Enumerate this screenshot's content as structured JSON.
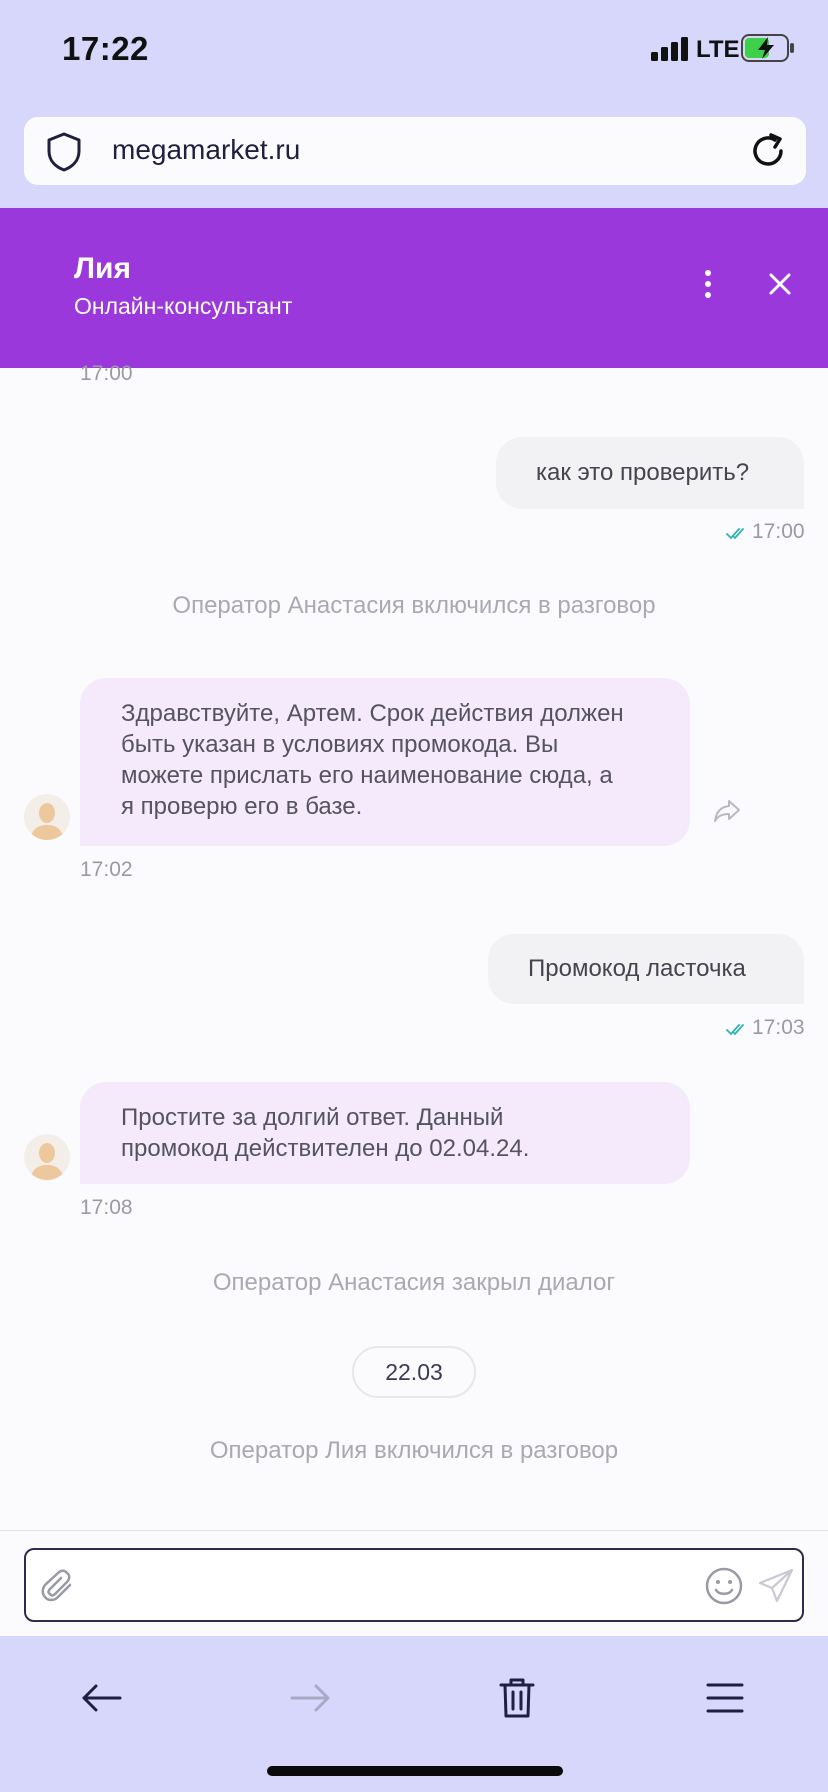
{
  "status_bar": {
    "time": "17:22",
    "network": "LTE"
  },
  "browser": {
    "url": "megamarket.ru"
  },
  "chat_header": {
    "name": "Лия",
    "role": "Онлайн-консультант"
  },
  "messages": {
    "cut_time": "17:00",
    "out1": {
      "text": "как это проверить?",
      "time": "17:00"
    },
    "sys1": "Оператор Анастасия включился в разговор",
    "in1": {
      "lines": [
        "Здравствуйте, Артем. Срок действия должен",
        "быть указан в условиях промокода. Вы",
        "можете прислать его наименование сюда, а",
        "я проверю его в базе."
      ],
      "time": "17:02"
    },
    "out2": {
      "text": "Промокод ласточка",
      "time": "17:03"
    },
    "in2": {
      "lines": [
        "Простите за долгий ответ. Данный",
        "промокод действителен до 02.04.24."
      ],
      "time": "17:08"
    },
    "sys2": "Оператор Анастасия закрыл диалог",
    "date_chip": "22.03",
    "sys3": "Оператор Лия включился в разговор"
  },
  "input": {
    "value": "",
    "placeholder": ""
  },
  "colors": {
    "chrome_bg": "#d6d7fa",
    "header_bg": "#9b38dc",
    "incoming_bubble": "#f5eafb",
    "outgoing_bubble": "#f2f2f4",
    "read_ticks": "#2bb5b0"
  },
  "icons": {
    "browser": [
      "shield-icon",
      "reload-icon"
    ],
    "header": [
      "more-vertical-icon",
      "close-icon"
    ],
    "input": [
      "paperclip-icon",
      "emoji-icon",
      "send-icon"
    ],
    "toolbar": [
      "back-arrow-icon",
      "forward-arrow-icon",
      "trash-icon",
      "menu-icon"
    ]
  }
}
